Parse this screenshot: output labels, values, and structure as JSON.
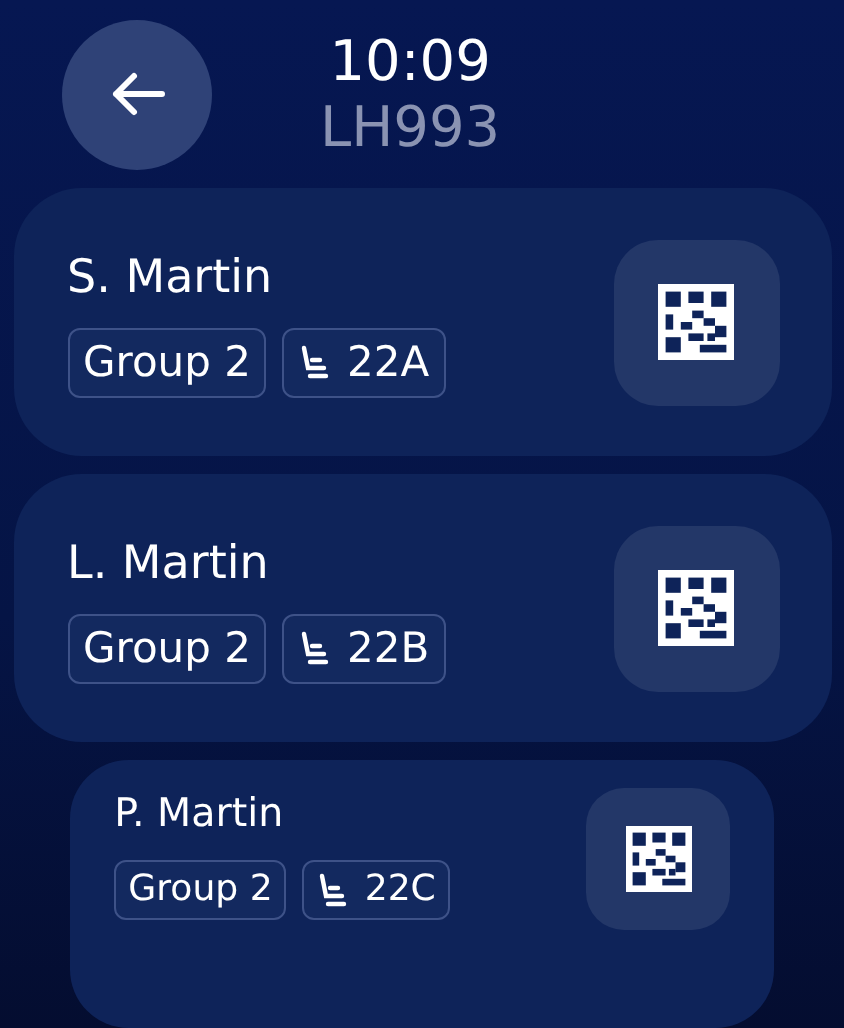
{
  "header": {
    "time": "10:09",
    "flight": "LH993"
  },
  "passengers": [
    {
      "name": "S. Martin",
      "group": "Group 2",
      "seat": "22A"
    },
    {
      "name": "L. Martin",
      "group": "Group 2",
      "seat": "22B"
    },
    {
      "name": "P. Martin",
      "group": "Group 2",
      "seat": "22C"
    }
  ]
}
